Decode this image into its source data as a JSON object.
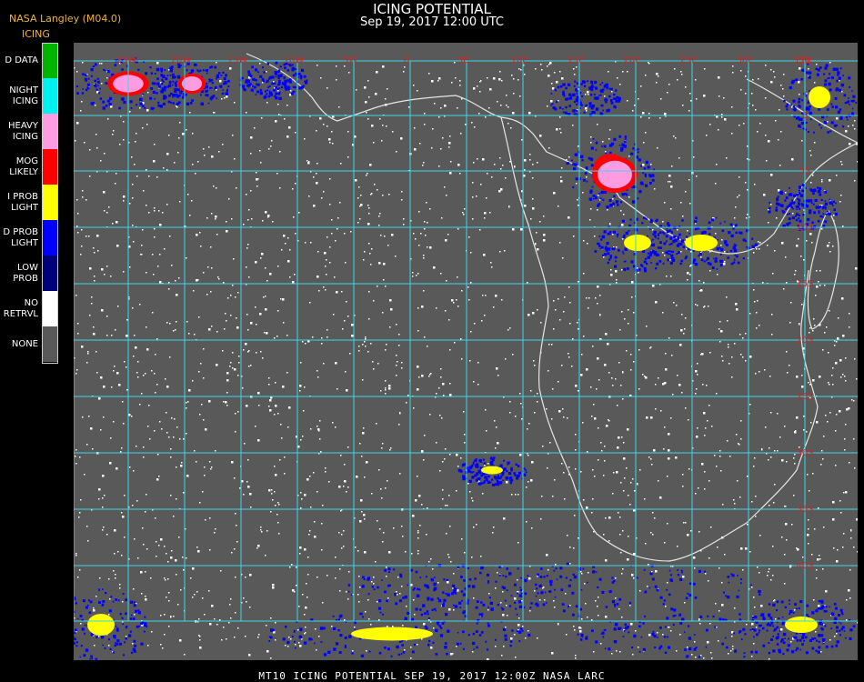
{
  "header": {
    "source": "NASA Langley (M04.0)",
    "layer": "ICING",
    "title": "ICING POTENTIAL",
    "subtitle": "Sep 19, 2017 12:00 UTC"
  },
  "legend": [
    {
      "label": "D DATA",
      "color": "#00b400"
    },
    {
      "label": "NIGHT\nICING",
      "color": "#00f0f0"
    },
    {
      "label": "HEAVY\nICING",
      "color": "#ff9ce1"
    },
    {
      "label": "MOG\nLIKELY",
      "color": "#ff0000"
    },
    {
      "label": "I PROB\nLIGHT",
      "color": "#ffff00"
    },
    {
      "label": "D PROB\nLIGHT",
      "color": "#0000ff"
    },
    {
      "label": "LOW\nPROB",
      "color": "#00007a"
    },
    {
      "label": "NO\nRETRVL",
      "color": "#ffffff"
    },
    {
      "label": "NONE",
      "color": "#595959"
    }
  ],
  "map": {
    "grid_color": "#3fd6e6",
    "coast_color": "#e6e6e6",
    "longitude_labels": [
      "25W",
      "20W",
      "15W",
      "10W",
      "5W",
      "0",
      "5E",
      "10E",
      "15E",
      "20E",
      "25E",
      "30E",
      "35E"
    ],
    "latitude_labels": [
      "5N",
      "0",
      "5S",
      "10S",
      "15S",
      "20S",
      "25S",
      "30S",
      "35S",
      "40S"
    ]
  },
  "footer": "MT10  ICING POTENTIAL   SEP 19, 2017 12:00Z   NASA LARC"
}
